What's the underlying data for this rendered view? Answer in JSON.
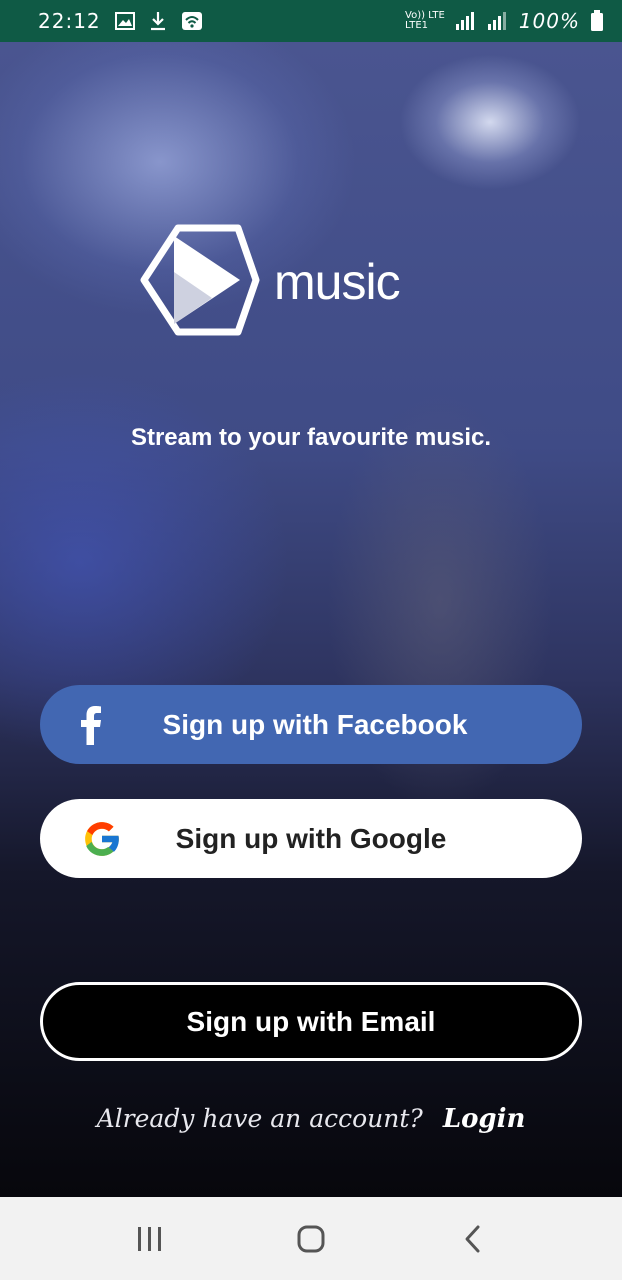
{
  "status_bar": {
    "time": "22:12",
    "network_top": "Vo)) LTE",
    "network_bottom": "LTE1",
    "battery": "100%"
  },
  "app": {
    "brand_name": "music",
    "tagline": "Stream to your favourite music."
  },
  "buttons": {
    "facebook_label": "Sign up with Facebook",
    "google_label": "Sign up with Google",
    "email_label": "Sign up with Email"
  },
  "login": {
    "prompt": "Already have an account?",
    "link": "Login"
  },
  "colors": {
    "status_bar": "#0f5a45",
    "facebook": "#4267b2",
    "google_button": "#ffffff",
    "email_button": "#000000"
  },
  "icons": {
    "brand": "play-hexagon-icon",
    "facebook": "facebook-f-icon",
    "google": "google-g-icon",
    "nav_recent": "recent-apps-icon",
    "nav_home": "home-icon",
    "nav_back": "back-icon"
  }
}
